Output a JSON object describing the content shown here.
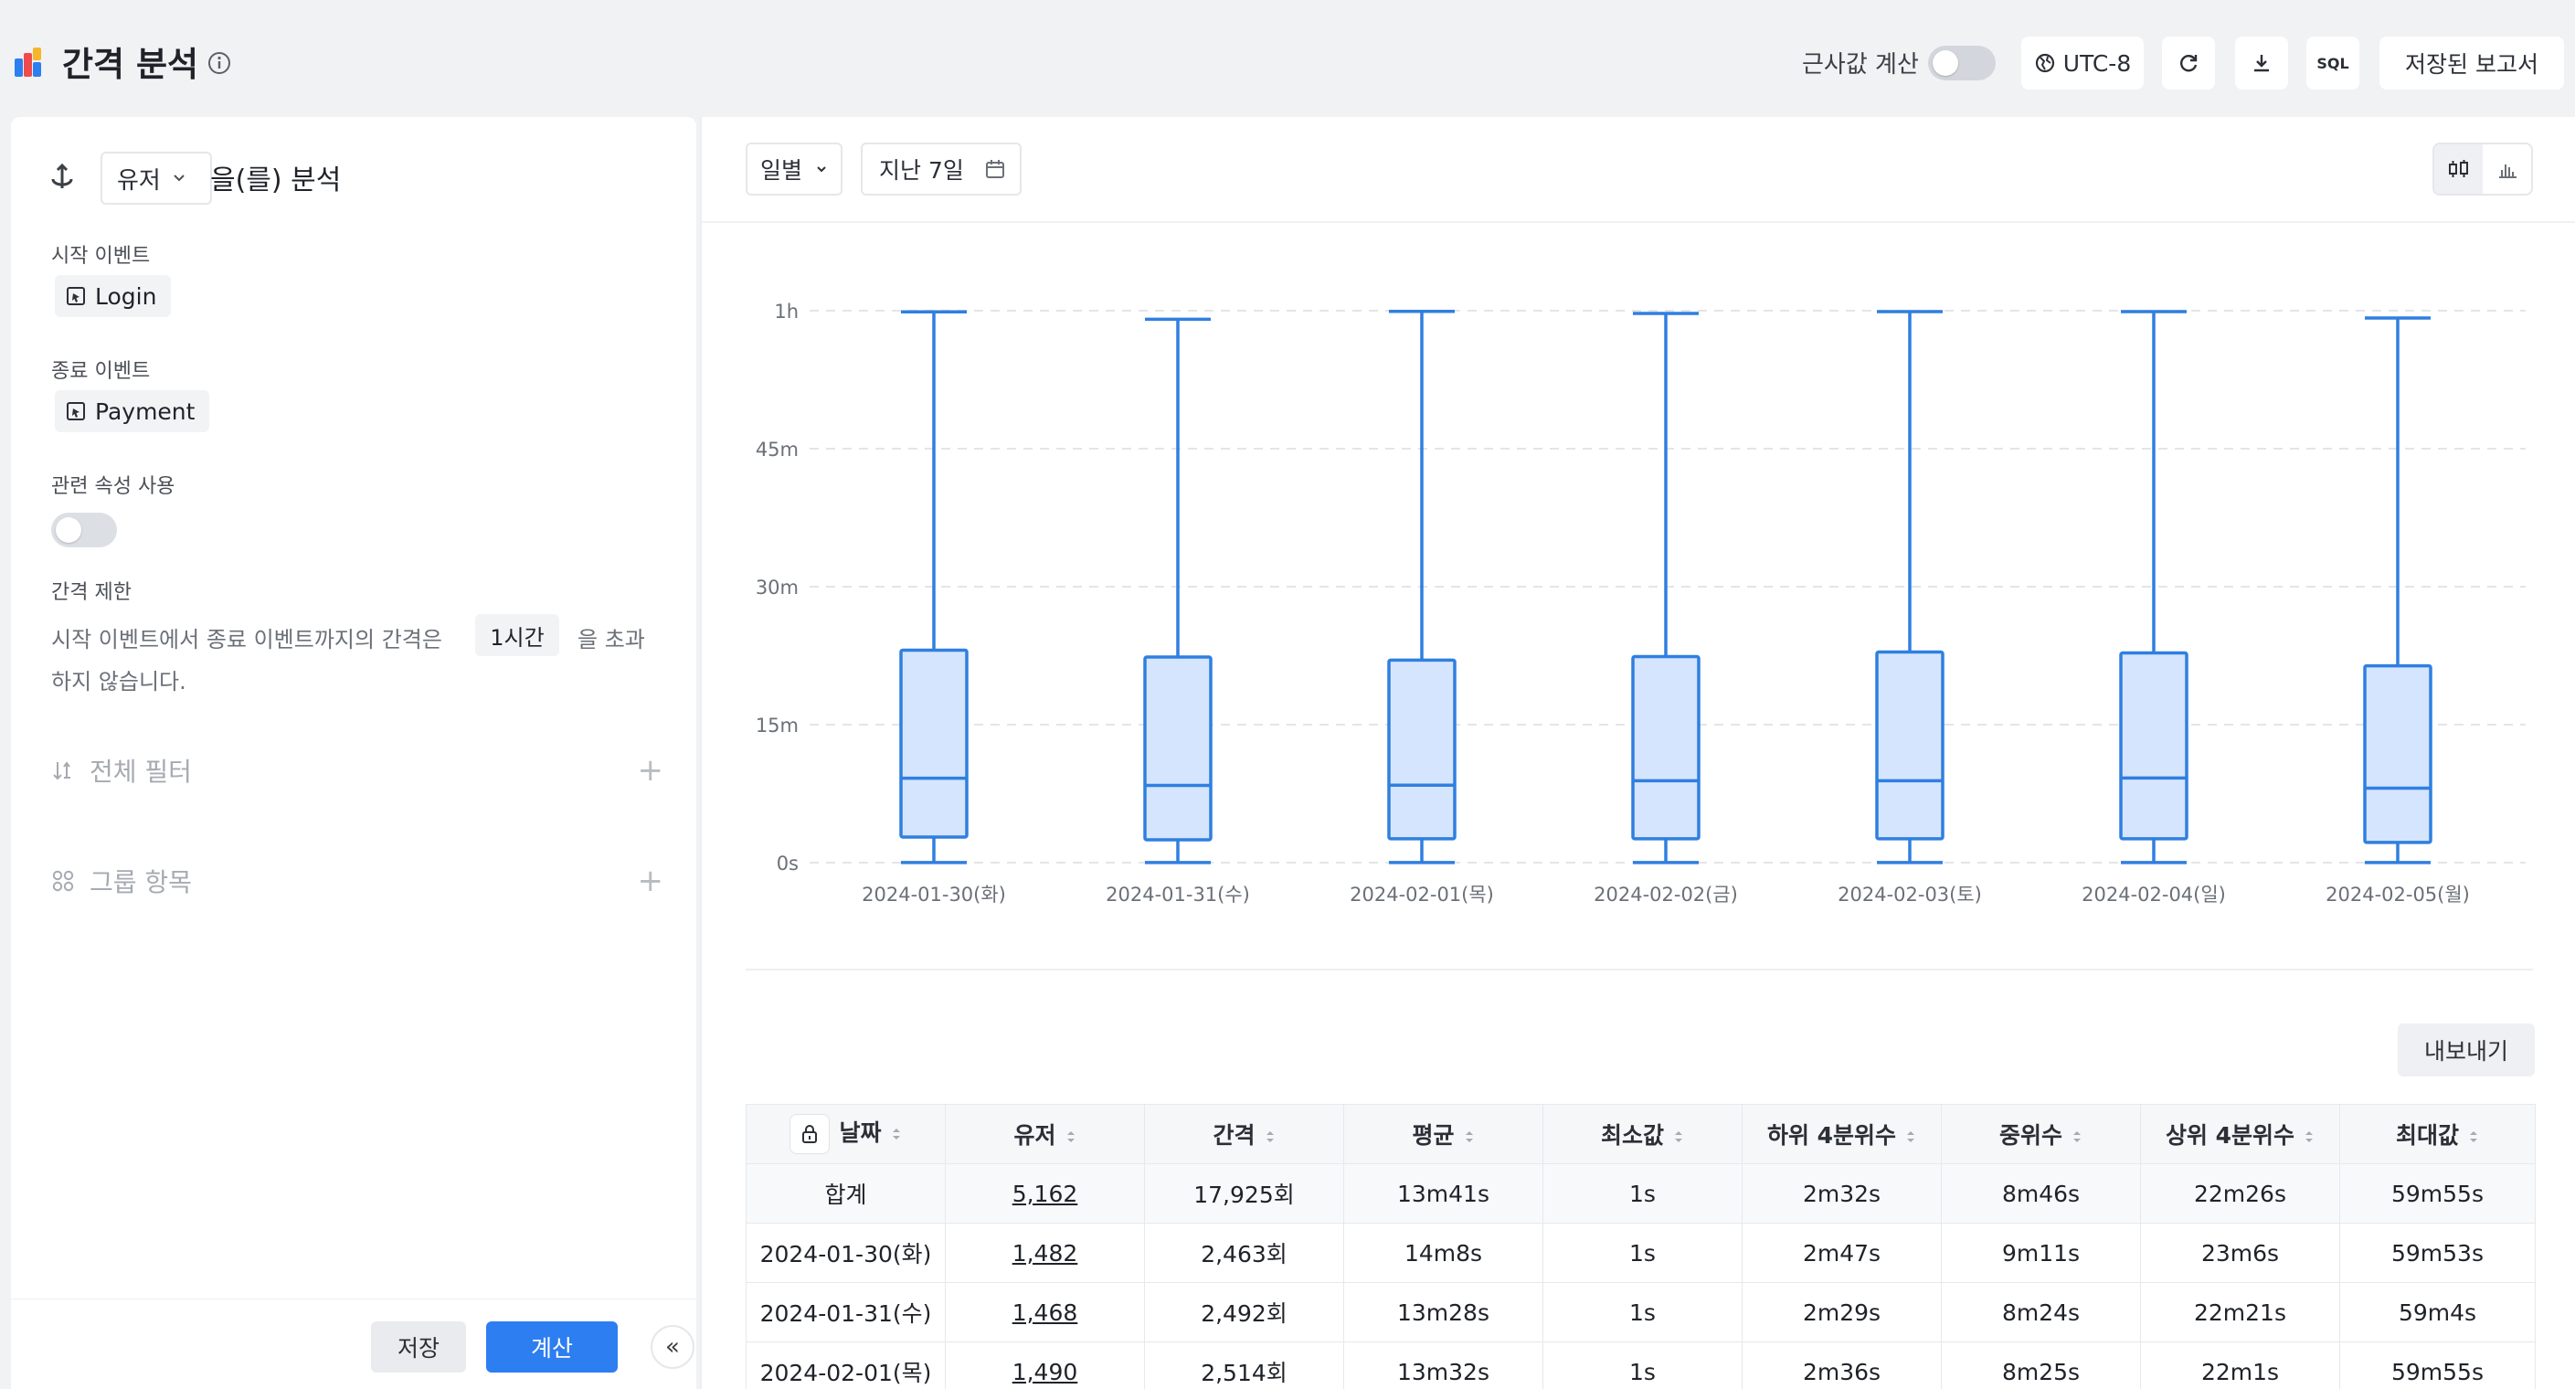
{
  "header": {
    "title": "간격 분석",
    "adjust_label": "근사값 계산",
    "adjust_on": false,
    "timezone": "UTC-8",
    "sql_label": "SQL",
    "saved_reports_label": "저장된 보고서"
  },
  "left": {
    "subject_select": "유저",
    "analysis_suffix": "을(를) 분석",
    "start_event_label": "시작 이벤트",
    "start_event": "Login",
    "end_event_label": "종료 이벤트",
    "end_event": "Payment",
    "related_prop_label": "관련 속성 사용",
    "related_prop_on": false,
    "interval_limit_label": "간격 제한",
    "limit_text_1": "시작 이벤트에서 종료 이벤트까지의 간격은",
    "limit_value": "1시간",
    "limit_text_2": "을 초과",
    "limit_text_3": "하지 않습니다.",
    "global_filter_label": "전체 필터",
    "group_label": "그룹 항목",
    "save_label": "저장",
    "calc_label": "계산",
    "collapse_label": "«"
  },
  "toolbar": {
    "granularity": "일별",
    "date_range": "지난 7일",
    "active_view": "boxplot"
  },
  "colors": {
    "accent": "#2d7ef1",
    "box_stroke": "#2f7fe0",
    "box_fill": "#d5e5fd"
  },
  "chart_data": {
    "type": "boxplot",
    "y_unit": "minutes",
    "ylim": [
      0,
      60
    ],
    "y_ticks": [
      {
        "value": 0,
        "label": "0s"
      },
      {
        "value": 15,
        "label": "15m"
      },
      {
        "value": 30,
        "label": "30m"
      },
      {
        "value": 45,
        "label": "45m"
      },
      {
        "value": 60,
        "label": "1h"
      }
    ],
    "grid": "horizontal-dashed",
    "categories": [
      "2024-01-30(화)",
      "2024-01-31(수)",
      "2024-02-01(목)",
      "2024-02-02(금)",
      "2024-02-03(토)",
      "2024-02-04(일)",
      "2024-02-05(월)"
    ],
    "min": [
      0.017,
      0.017,
      0.017,
      0.017,
      0.017,
      0.017,
      0.017
    ],
    "q1": [
      2.78,
      2.48,
      2.6,
      2.6,
      2.6,
      2.6,
      2.2
    ],
    "median": [
      9.18,
      8.4,
      8.42,
      8.9,
      8.9,
      9.2,
      8.1
    ],
    "q3": [
      23.1,
      22.35,
      22.02,
      22.4,
      22.9,
      22.8,
      21.4
    ],
    "max": [
      59.88,
      59.07,
      59.92,
      59.7,
      59.9,
      59.9,
      59.2
    ]
  },
  "export_label": "내보내기",
  "table": {
    "headers": [
      "날짜",
      "유저",
      "간격",
      "평균",
      "최소값",
      "하위 4분위수",
      "중위수",
      "상위 4분위수",
      "최대값"
    ],
    "total": [
      "합계",
      "5,162",
      "17,925회",
      "13m41s",
      "1s",
      "2m32s",
      "8m46s",
      "22m26s",
      "59m55s"
    ],
    "rows": [
      [
        "2024-01-30(화)",
        "1,482",
        "2,463회",
        "14m8s",
        "1s",
        "2m47s",
        "9m11s",
        "23m6s",
        "59m53s"
      ],
      [
        "2024-01-31(수)",
        "1,468",
        "2,492회",
        "13m28s",
        "1s",
        "2m29s",
        "8m24s",
        "22m21s",
        "59m4s"
      ],
      [
        "2024-02-01(목)",
        "1,490",
        "2,514회",
        "13m32s",
        "1s",
        "2m36s",
        "8m25s",
        "22m1s",
        "59m55s"
      ]
    ]
  }
}
